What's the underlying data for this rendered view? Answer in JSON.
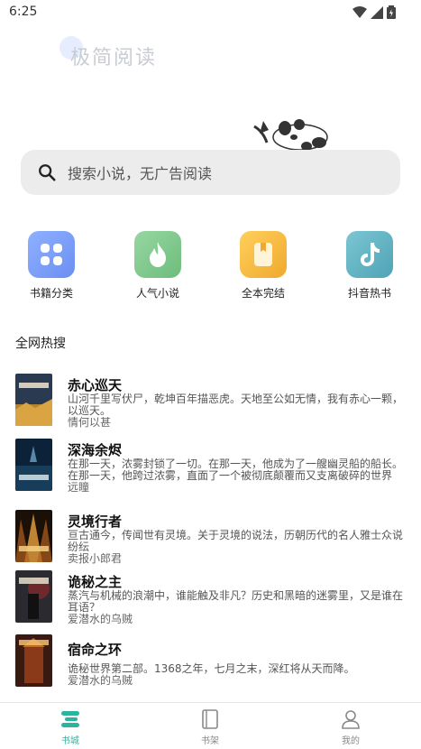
{
  "status_bar": {
    "time": "6:25"
  },
  "logo": {
    "text": "极简阅读"
  },
  "search": {
    "placeholder": "搜索小说，无广告阅读"
  },
  "categories": [
    {
      "label": "书籍分类",
      "icon": "grid-icon",
      "color": "#6b8ff2"
    },
    {
      "label": "人气小说",
      "icon": "flame-icon",
      "color": "#76c585"
    },
    {
      "label": "全本完结",
      "icon": "book-icon",
      "color": "#f5b63f"
    },
    {
      "label": "抖音热书",
      "icon": "tiktok-icon",
      "color": "#5fb2c3"
    }
  ],
  "hot_section": {
    "title": "全网热搜"
  },
  "books": [
    {
      "title": "赤心巡天",
      "desc": "山河千里写伏尸，乾坤百年描恶虎。天地至公如无情，我有赤心一颗，以巡天。",
      "author": "情何以甚"
    },
    {
      "title": "深海余烬",
      "desc": "在那一天，浓雾封锁了一切。在那一天，他成为了一艘幽灵船的船长。在那一天，他跨过浓雾，直面了一个被彻底颠覆而又支离破碎的世界",
      "author": "远瞳"
    },
    {
      "title": "灵境行者",
      "desc": "亘古通今，传闻世有灵境。关于灵境的说法，历朝历代的名人雅士众说纷纭",
      "author": "卖报小郎君"
    },
    {
      "title": "诡秘之主",
      "desc": "蒸汽与机械的浪潮中，谁能触及非凡？历史和黑暗的迷雾里，又是谁在耳语？",
      "author": "爱潜水的乌贼"
    },
    {
      "title": "宿命之环",
      "desc": "诡秘世界第二部。1368之年，七月之末，深红将从天而降。",
      "author": "爱潜水的乌贼"
    }
  ],
  "bottom_nav": [
    {
      "label": "书城",
      "icon": "store-icon",
      "active": true
    },
    {
      "label": "书架",
      "icon": "bookshelf-icon",
      "active": false
    },
    {
      "label": "我的",
      "icon": "user-icon",
      "active": false
    }
  ],
  "colors": {
    "accent": "#2bb5a0",
    "search_bg": "#ececec"
  }
}
